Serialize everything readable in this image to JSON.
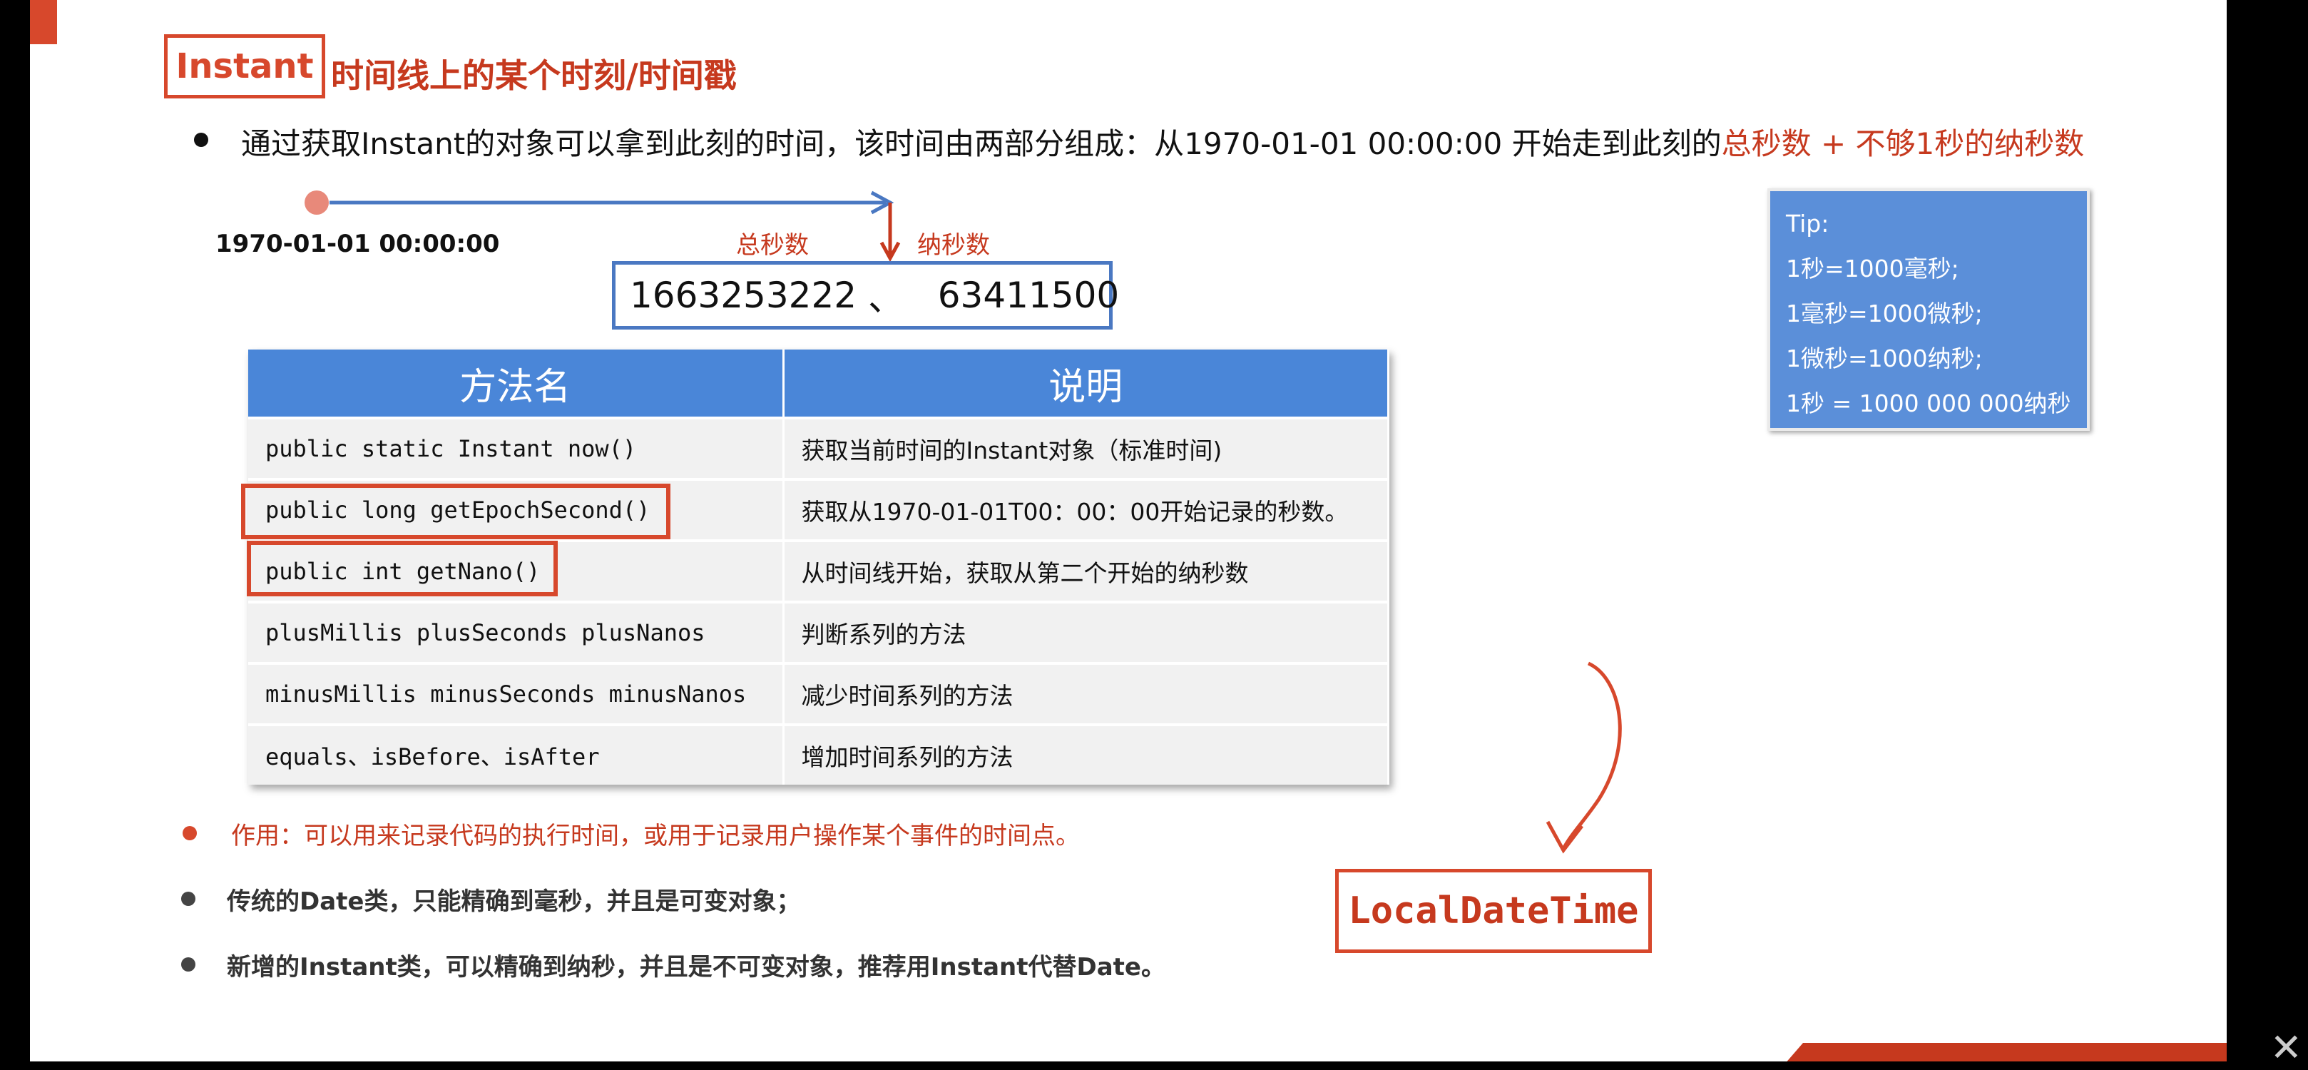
{
  "title": {
    "keyword": "Instant",
    "text": "时间线上的某个时刻/时间戳"
  },
  "intro": {
    "prefix": "通过获取Instant的对象可以拿到此刻的时间，该时间由两部分组成：从1970-01-01 00:00:00 开始走到此刻的",
    "highlight": "总秒数 + 不够1秒的纳秒数"
  },
  "timeline": {
    "epoch": "1970-01-01 00:00:00",
    "seconds_label": "总秒数",
    "nanos_label": "纳秒数",
    "seconds_value": "1663253222",
    "separator": "、",
    "nanos_value": "63411500"
  },
  "tip": {
    "lines": [
      "Tip:",
      "1秒=1000毫秒;",
      "1毫秒=1000微秒;",
      "1微秒=1000纳秒;",
      "1秒 = 1000 000 000纳秒"
    ]
  },
  "table": {
    "headers": [
      "方法名",
      "说明"
    ],
    "rows": [
      {
        "method": "public static Instant now()",
        "desc": "获取当前时间的Instant对象（标准时间)"
      },
      {
        "method": "public long getEpochSecond()",
        "desc": "获取从1970-01-01T00：00：00开始记录的秒数。"
      },
      {
        "method": "public int getNano()",
        "desc": "从时间线开始，获取从第二个开始的纳秒数"
      },
      {
        "method": "plusMillis plusSeconds plusNanos",
        "desc": "判断系列的方法"
      },
      {
        "method": "minusMillis minusSeconds minusNanos",
        "desc": "减少时间系列的方法"
      },
      {
        "method": "equals、isBefore、isAfter",
        "desc": "增加时间系列的方法"
      }
    ]
  },
  "bullets": {
    "usage": "作用：可以用来记录代码的执行时间，或用于记录用户操作某个事件的时间点。",
    "date_class": "传统的Date类，只能精确到毫秒，并且是可变对象；",
    "instant_class": "新增的Instant类，可以精确到纳秒，并且是不可变对象，推荐用Instant代替Date。"
  },
  "annotation": {
    "label": "LocalDateTime"
  },
  "colors": {
    "accent_red": "#d7482c",
    "header_blue": "#4a86d8",
    "tip_blue": "#5b8fd9"
  }
}
